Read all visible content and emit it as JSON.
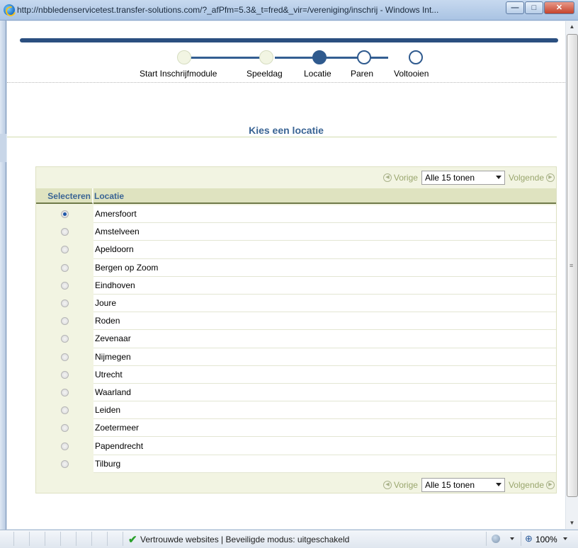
{
  "window": {
    "title": "http://nbbledenservicetest.transfer-solutions.com/?_afPfm=5.3&_t=fred&_vir=/vereniging/inschrij - Windows Int...",
    "min_label": "—",
    "max_label": "□",
    "close_label": "✕"
  },
  "train": {
    "steps": [
      {
        "label": "Start Inschrijfmodule",
        "state": "visited"
      },
      {
        "label": "Speeldag",
        "state": "visited"
      },
      {
        "label": "Locatie",
        "state": "current"
      },
      {
        "label": "Paren",
        "state": "future"
      },
      {
        "label": "Voltooien",
        "state": "future"
      }
    ]
  },
  "page": {
    "header": "Kies een locatie"
  },
  "table": {
    "nav": {
      "prev": "Vorige",
      "next": "Volgende",
      "range": "Alle 15 tonen",
      "prev_icon": "◀",
      "next_icon": "▶"
    },
    "columns": {
      "select": "Selecteren",
      "location": "Locatie"
    },
    "selected_index": 0,
    "rows": [
      "Amersfoort",
      "Amstelveen",
      "Apeldoorn",
      "Bergen op Zoom",
      "Eindhoven",
      "Joure",
      "Roden",
      "Zevenaar",
      "Nijmegen",
      "Utrecht",
      "Waarland",
      "Leiden",
      "Zoetermeer",
      "Papendrecht",
      "Tilburg"
    ]
  },
  "statusbar": {
    "text": "Vertrouwde websites | Beveiligde modus: uitgeschakeld",
    "zoom": "100%",
    "check_glyph": "✔",
    "zoom_glyph": "⊕"
  },
  "scrollbar": {
    "up": "▲",
    "down": "▼",
    "grip": "≡"
  },
  "colors": {
    "accent": "#3a6494",
    "train": "#2f5a8e",
    "table_bg": "#f2f4e2",
    "header_bg": "#dfe3c0",
    "nav_disabled": "#9aa66e"
  }
}
